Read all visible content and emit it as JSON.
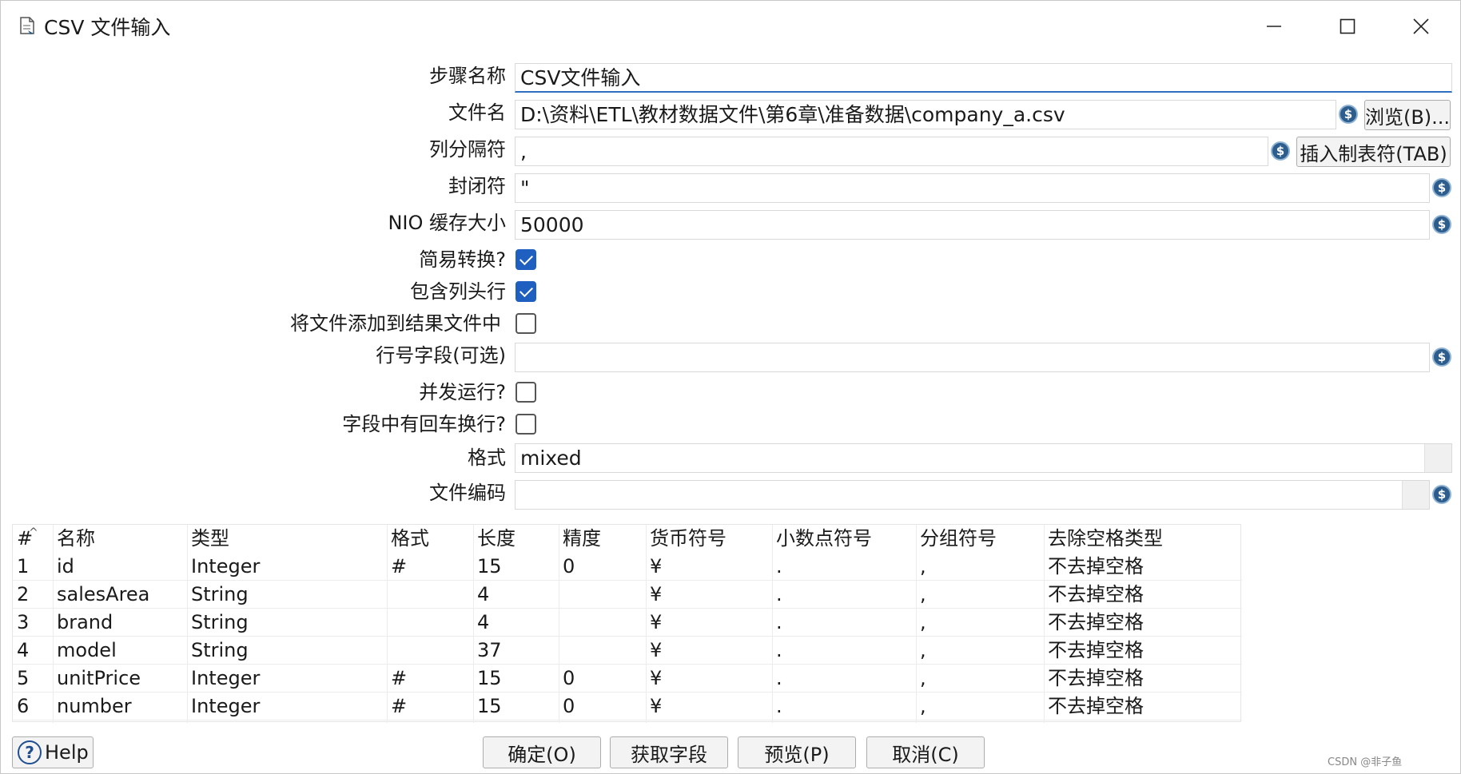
{
  "window": {
    "title": "CSV 文件输入",
    "min_glyph": "—",
    "max_glyph": "☐",
    "close_glyph": "✕"
  },
  "form": {
    "step_name_label": "步骤名称",
    "step_name_value": "CSV文件输入",
    "filename_label": "文件名",
    "filename_value": "D:\\资料\\ETL\\教材数据文件\\第6章\\准备数据\\company_a.csv",
    "browse_label": "浏览(B)...",
    "delimiter_label": "列分隔符",
    "delimiter_value": ",",
    "insert_tab_label": "插入制表符(TAB)",
    "enclosure_label": "封闭符",
    "enclosure_value": "\"",
    "nio_label": "NIO 缓存大小",
    "nio_value": "50000",
    "lazy_conversion_label": "简易转换?",
    "lazy_conversion_checked": true,
    "header_row_label": "包含列头行",
    "header_row_checked": true,
    "add_to_result_label": "将文件添加到结果文件中",
    "add_to_result_checked": false,
    "row_num_field_label": "行号字段(可选)",
    "row_num_field_value": "",
    "parallel_label": "并发运行?",
    "parallel_checked": false,
    "newline_in_field_label": "字段中有回车换行?",
    "newline_in_field_checked": false,
    "format_label": "格式",
    "format_value": "mixed",
    "encoding_label": "文件编码",
    "encoding_value": "",
    "var_icon_glyph": "$"
  },
  "table": {
    "columns": [
      "#",
      "名称",
      "类型",
      "格式",
      "长度",
      "精度",
      "货币符号",
      "小数点符号",
      "分组符号",
      "去除空格类型"
    ],
    "rows": [
      [
        "1",
        "id",
        "Integer",
        "#",
        "15",
        "0",
        "¥",
        ".",
        ",",
        "不去掉空格"
      ],
      [
        "2",
        "salesArea",
        "String",
        "",
        "4",
        "",
        "¥",
        ".",
        ",",
        "不去掉空格"
      ],
      [
        "3",
        "brand",
        "String",
        "",
        "4",
        "",
        "¥",
        ".",
        ",",
        "不去掉空格"
      ],
      [
        "4",
        "model",
        "String",
        "",
        "37",
        "",
        "¥",
        ".",
        ",",
        "不去掉空格"
      ],
      [
        "5",
        "unitPrice",
        "Integer",
        "#",
        "15",
        "0",
        "¥",
        ".",
        ",",
        "不去掉空格"
      ],
      [
        "6",
        "number",
        "Integer",
        "#",
        "15",
        "0",
        "¥",
        ".",
        ",",
        "不去掉空格"
      ]
    ]
  },
  "buttons": {
    "help": "Help",
    "ok": "确定(O)",
    "get_fields": "获取字段",
    "preview": "预览(P)",
    "cancel": "取消(C)"
  },
  "watermark": "CSDN @非子鱼"
}
